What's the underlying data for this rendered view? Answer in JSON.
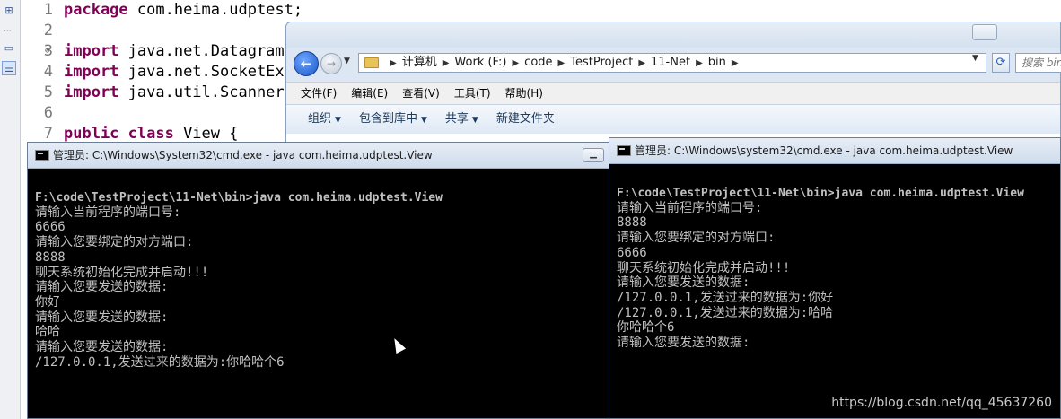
{
  "editor": {
    "lines": [
      {
        "num": "1",
        "keyword": "package",
        "rest": " com.heima.udptest;"
      },
      {
        "num": "2",
        "keyword": "",
        "rest": ""
      },
      {
        "num": "3",
        "keyword": "import",
        "rest": " java.net.Datagram"
      },
      {
        "num": "4",
        "keyword": "import",
        "rest": " java.net.SocketEx"
      },
      {
        "num": "5",
        "keyword": "import",
        "rest": " java.util.Scanner"
      },
      {
        "num": "6",
        "keyword": "",
        "rest": ""
      },
      {
        "num": "7",
        "keyword": "public class",
        "rest": " View {"
      }
    ]
  },
  "explorer": {
    "breadcrumb": [
      "计算机",
      "Work (F:)",
      "code",
      "TestProject",
      "11-Net",
      "bin"
    ],
    "search_placeholder": "搜索 bin",
    "menu": [
      "文件(F)",
      "编辑(E)",
      "查看(V)",
      "工具(T)",
      "帮助(H)"
    ],
    "commands": [
      {
        "label": "组织",
        "caret": "▼"
      },
      {
        "label": "包含到库中",
        "caret": "▼"
      },
      {
        "label": "共享",
        "caret": "▼"
      },
      {
        "label": "新建文件夹",
        "caret": ""
      }
    ]
  },
  "cmd_left": {
    "title": "管理员: C:\\Windows\\System32\\cmd.exe - java  com.heima.udptest.View",
    "lines": [
      "F:\\code\\TestProject\\11-Net\\bin>java com.heima.udptest.View",
      "请输入当前程序的端口号:",
      "6666",
      "请输入您要绑定的对方端口:",
      "8888",
      "聊天系统初始化完成并启动!!!",
      "请输入您要发送的数据:",
      "你好",
      "请输入您要发送的数据:",
      "哈哈",
      "请输入您要发送的数据:",
      "/127.0.0.1,发送过来的数据为:你哈哈个6"
    ]
  },
  "cmd_right": {
    "title": "管理员: C:\\Windows\\system32\\cmd.exe - java  com.heima.udptest.View",
    "lines": [
      "F:\\code\\TestProject\\11-Net\\bin>java com.heima.udptest.View",
      "请输入当前程序的端口号:",
      "8888",
      "请输入您要绑定的对方端口:",
      "6666",
      "聊天系统初始化完成并启动!!!",
      "请输入您要发送的数据:",
      "/127.0.0.1,发送过来的数据为:你好",
      "/127.0.0.1,发送过来的数据为:哈哈",
      "你哈哈个6",
      "请输入您要发送的数据:"
    ]
  },
  "watermark": "https://blog.csdn.net/qq_45637260",
  "colors": {
    "keyword": "#7f0055",
    "console_bg": "#000000",
    "console_text": "#c0c0c0"
  },
  "icons": {
    "explorer_back": "back-arrow-icon",
    "explorer_forward": "forward-arrow-icon",
    "explorer_refresh": "refresh-icon",
    "explorer_folder": "folder-icon",
    "cmd": "cmd-icon",
    "cursor": "mouse-cursor-icon"
  }
}
